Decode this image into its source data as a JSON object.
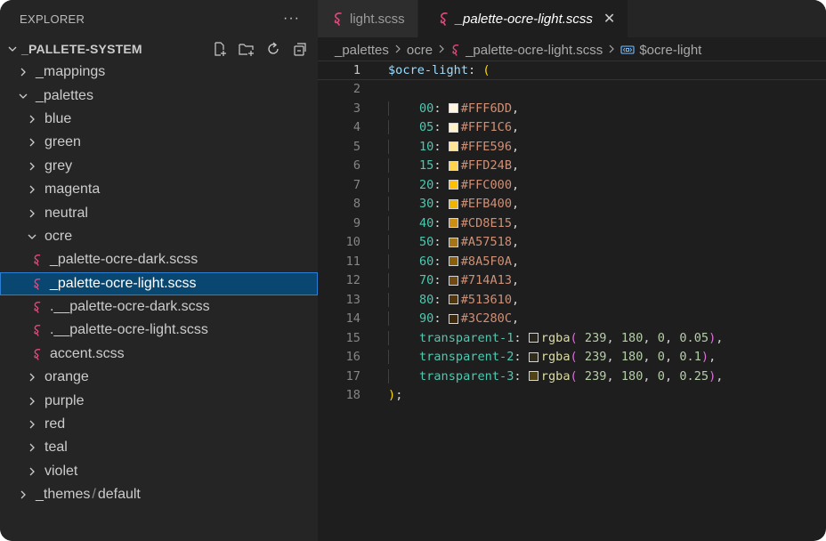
{
  "sidebar": {
    "title": "EXPLORER",
    "more_label": "···",
    "root_label": "_PALLETE-SYSTEM",
    "tree": [
      {
        "label": "_mappings",
        "depth": 1,
        "kind": "folder",
        "open": false
      },
      {
        "label": "_palettes",
        "depth": 1,
        "kind": "folder",
        "open": true
      },
      {
        "label": "blue",
        "depth": 2,
        "kind": "folder",
        "open": false
      },
      {
        "label": "green",
        "depth": 2,
        "kind": "folder",
        "open": false
      },
      {
        "label": "grey",
        "depth": 2,
        "kind": "folder",
        "open": false
      },
      {
        "label": "magenta",
        "depth": 2,
        "kind": "folder",
        "open": false
      },
      {
        "label": "neutral",
        "depth": 2,
        "kind": "folder",
        "open": false
      },
      {
        "label": "ocre",
        "depth": 2,
        "kind": "folder",
        "open": true
      },
      {
        "label": "_palette-ocre-dark.scss",
        "depth": 3,
        "kind": "file"
      },
      {
        "label": "_palette-ocre-light.scss",
        "depth": 3,
        "kind": "file",
        "selected": true
      },
      {
        "label": ".__palette-ocre-dark.scss",
        "depth": 3,
        "kind": "file"
      },
      {
        "label": ".__palette-ocre-light.scss",
        "depth": 3,
        "kind": "file"
      },
      {
        "label": "accent.scss",
        "depth": 3,
        "kind": "file"
      },
      {
        "label": "orange",
        "depth": 2,
        "kind": "folder",
        "open": false
      },
      {
        "label": "purple",
        "depth": 2,
        "kind": "folder",
        "open": false
      },
      {
        "label": "red",
        "depth": 2,
        "kind": "folder",
        "open": false
      },
      {
        "label": "teal",
        "depth": 2,
        "kind": "folder",
        "open": false
      },
      {
        "label": "violet",
        "depth": 2,
        "kind": "folder",
        "open": false
      },
      {
        "label": "_themes",
        "label2": "default",
        "depth": 1,
        "kind": "folder",
        "open": false
      }
    ]
  },
  "tabs": [
    {
      "label": "light.scss",
      "active": false
    },
    {
      "label": "_palette-ocre-light.scss",
      "active": true,
      "close": "✕"
    }
  ],
  "breadcrumb": {
    "items": [
      "_palettes",
      "ocre",
      "_palette-ocre-light.scss"
    ],
    "symbol": "$ocre-light"
  },
  "editor": {
    "lines": [
      {
        "n": "1",
        "type": "open",
        "var": "$ocre-light",
        "rest": ": ",
        "paren": "("
      },
      {
        "n": "2",
        "type": "blank"
      },
      {
        "n": "3",
        "type": "hex",
        "key": "00",
        "value": "#FFF6DD",
        "color": "#FFF6DD"
      },
      {
        "n": "4",
        "type": "hex",
        "key": "05",
        "value": "#FFF1C6",
        "color": "#FFF1C6"
      },
      {
        "n": "5",
        "type": "hex",
        "key": "10",
        "value": "#FFE596",
        "color": "#FFE596"
      },
      {
        "n": "6",
        "type": "hex",
        "key": "15",
        "value": "#FFD24B",
        "color": "#FFD24B"
      },
      {
        "n": "7",
        "type": "hex",
        "key": "20",
        "value": "#FFC000",
        "color": "#FFC000"
      },
      {
        "n": "8",
        "type": "hex",
        "key": "30",
        "value": "#EFB400",
        "color": "#EFB400"
      },
      {
        "n": "9",
        "type": "hex",
        "key": "40",
        "value": "#CD8E15",
        "color": "#CD8E15"
      },
      {
        "n": "10",
        "type": "hex",
        "key": "50",
        "value": "#A57518",
        "color": "#A57518"
      },
      {
        "n": "11",
        "type": "hex",
        "key": "60",
        "value": "#8A5F0A",
        "color": "#8A5F0A"
      },
      {
        "n": "12",
        "type": "hex",
        "key": "70",
        "value": "#714A13",
        "color": "#714A13"
      },
      {
        "n": "13",
        "type": "hex",
        "key": "80",
        "value": "#513610",
        "color": "#513610"
      },
      {
        "n": "14",
        "type": "hex",
        "key": "90",
        "value": "#3C280C",
        "color": "#3C280C"
      },
      {
        "n": "15",
        "type": "rgba",
        "key": "transparent-1",
        "fn": "rgba",
        "args": [
          " 239",
          " 180",
          " 0",
          " 0.05"
        ],
        "color": "rgba(239,180,0,0.05)"
      },
      {
        "n": "16",
        "type": "rgba",
        "key": "transparent-2",
        "fn": "rgba",
        "args": [
          " 239",
          " 180",
          " 0",
          " 0.1"
        ],
        "color": "rgba(239,180,0,0.1)"
      },
      {
        "n": "17",
        "type": "rgba",
        "key": "transparent-3",
        "fn": "rgba",
        "args": [
          " 239",
          " 180",
          " 0",
          " 0.25"
        ],
        "color": "rgba(239,180,0,0.25)"
      },
      {
        "n": "18",
        "type": "close",
        "paren": ")",
        "rest": ";"
      }
    ]
  },
  "colors": {
    "sass_icon": "#e5487b",
    "selection": "#094771",
    "symbol_icon": "#75beff"
  }
}
